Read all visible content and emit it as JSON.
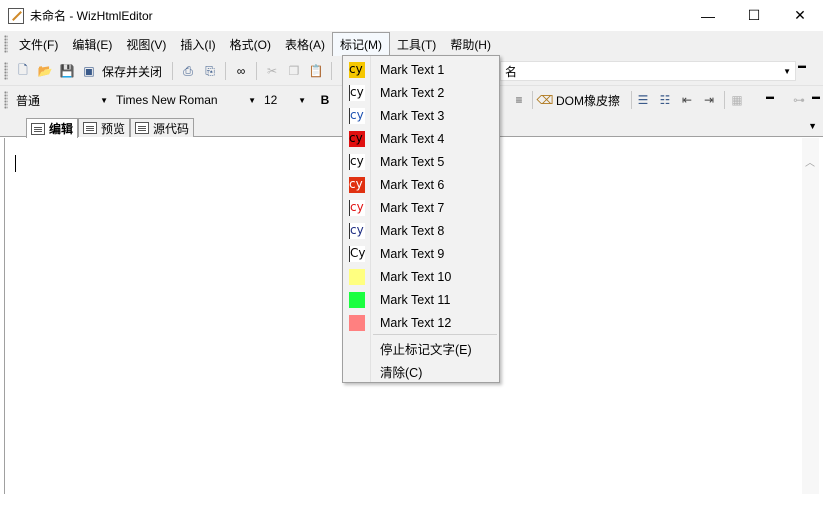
{
  "window": {
    "title": "未命名 - WizHtmlEditor",
    "minimize": "—",
    "maximize": "☐",
    "close": "✕"
  },
  "menubar": {
    "items": [
      {
        "label": "文件(F)"
      },
      {
        "label": "编辑(E)"
      },
      {
        "label": "视图(V)"
      },
      {
        "label": "插入(I)"
      },
      {
        "label": "格式(O)"
      },
      {
        "label": "表格(A)"
      },
      {
        "label": "标记(M)"
      },
      {
        "label": "工具(T)"
      },
      {
        "label": "帮助(H)"
      }
    ]
  },
  "toolbar1": {
    "save_close_label": "保存并关闭",
    "title_field_value": "名"
  },
  "toolbar2": {
    "paragraph_style": "普通",
    "font_name": "Times New Roman",
    "font_size": "12",
    "bold_label": "B",
    "dom_eraser_label": "DOM橡皮擦"
  },
  "tabs": [
    {
      "label": "编辑"
    },
    {
      "label": "预览"
    },
    {
      "label": "源代码"
    }
  ],
  "mark_menu": {
    "items": [
      {
        "label": "Mark Text 1",
        "swatch_text": "cy",
        "bg": "#f6c700",
        "fg": "#000000"
      },
      {
        "label": "Mark Text 2",
        "swatch_text": "cy",
        "bg": "#ffffff",
        "fg": "#000000"
      },
      {
        "label": "Mark Text 3",
        "swatch_text": "cy",
        "bg": "#ffffff",
        "fg": "#1a4fb0"
      },
      {
        "label": "Mark Text 4",
        "swatch_text": "cy",
        "bg": "#e01010",
        "fg": "#000000"
      },
      {
        "label": "Mark Text 5",
        "swatch_text": "cy",
        "bg": "#ffffff",
        "fg": "#000000"
      },
      {
        "label": "Mark Text 6",
        "swatch_text": "cy",
        "bg": "#e03010",
        "fg": "#ffffff"
      },
      {
        "label": "Mark Text 7",
        "swatch_text": "cy",
        "bg": "#ffffff",
        "fg": "#e01010"
      },
      {
        "label": "Mark Text 8",
        "swatch_text": "cy",
        "bg": "#ffffff",
        "fg": "#1a2a80"
      },
      {
        "label": "Mark Text 9",
        "swatch_text": "Cyi",
        "bg": "#ffffff",
        "fg": "#000000"
      },
      {
        "label": "Mark Text 10",
        "swatch_text": "",
        "bg": "#ffff80",
        "fg": "#000000"
      },
      {
        "label": "Mark Text 11",
        "swatch_text": "",
        "bg": "#1aff40",
        "fg": "#000000"
      },
      {
        "label": "Mark Text 12",
        "swatch_text": "",
        "bg": "#ff8080",
        "fg": "#000000"
      }
    ],
    "stop_label": "停止标记文字(E)",
    "clear_label": "清除(C)"
  }
}
